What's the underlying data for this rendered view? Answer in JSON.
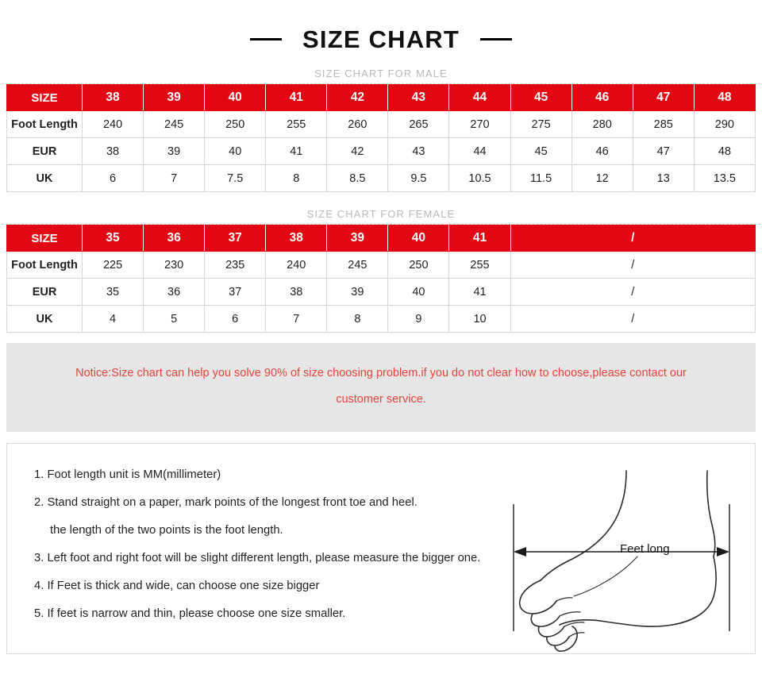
{
  "title": "SIZE CHART",
  "sections": {
    "male_caption": "SIZE CHART FOR MALE",
    "female_caption": "SIZE CHART FOR FEMALE"
  },
  "male_table": {
    "row_labels": [
      "SIZE",
      "Foot Length",
      "EUR",
      "UK"
    ],
    "sizes": [
      "38",
      "39",
      "40",
      "41",
      "42",
      "43",
      "44",
      "45",
      "46",
      "47",
      "48"
    ],
    "foot_length": [
      "240",
      "245",
      "250",
      "255",
      "260",
      "265",
      "270",
      "275",
      "280",
      "285",
      "290"
    ],
    "eur": [
      "38",
      "39",
      "40",
      "41",
      "42",
      "43",
      "44",
      "45",
      "46",
      "47",
      "48"
    ],
    "uk": [
      "6",
      "7",
      "7.5",
      "8",
      "8.5",
      "9.5",
      "10.5",
      "11.5",
      "12",
      "13",
      "13.5"
    ]
  },
  "female_table": {
    "row_labels": [
      "SIZE",
      "Foot Length",
      "EUR",
      "UK"
    ],
    "sizes": [
      "35",
      "36",
      "37",
      "38",
      "39",
      "40",
      "41"
    ],
    "foot_length": [
      "225",
      "230",
      "235",
      "240",
      "245",
      "250",
      "255"
    ],
    "eur": [
      "35",
      "36",
      "37",
      "38",
      "39",
      "40",
      "41"
    ],
    "uk": [
      "4",
      "5",
      "6",
      "7",
      "8",
      "9",
      "10"
    ],
    "empty_marker": "/"
  },
  "notice": {
    "line1": "Notice:Size chart can help you solve 90% of size choosing problem.if you do not clear how to choose,please contact our",
    "line2": "customer service."
  },
  "instructions": [
    "1. Foot length unit is MM(millimeter)",
    "2. Stand straight on a paper, mark points of the longest front toe and heel.",
    "the length of the two points is the foot length.",
    "3. Left foot and right foot will be slight different length, please measure the bigger one.",
    "4. If Feet is thick and wide, can choose one size bigger",
    "5. If feet is narrow and thin, please choose one size smaller."
  ],
  "diagram": {
    "measure_label": "Feet long"
  },
  "colors": {
    "header_red": "#e30613",
    "notice_red": "#e8433c",
    "notice_bg": "#e6e6e6",
    "caption_gray": "#b8b8b8"
  }
}
